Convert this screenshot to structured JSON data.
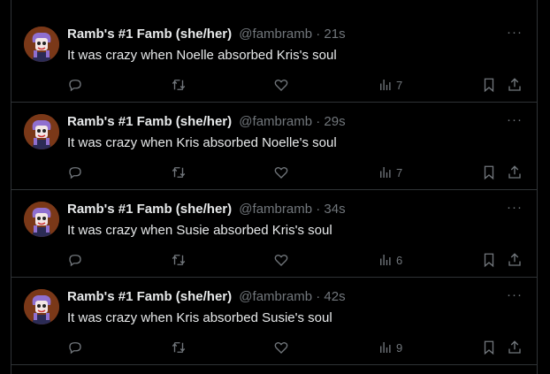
{
  "tweets": [
    {
      "name": "Ramb's #1 Famb (she/her)",
      "handle": "@fambramb",
      "sep": "·",
      "time": "21s",
      "text": "It was crazy when Noelle absorbed Kris's soul",
      "views": "7"
    },
    {
      "name": "Ramb's #1 Famb (she/her)",
      "handle": "@fambramb",
      "sep": "·",
      "time": "29s",
      "text": "It was crazy when Kris absorbed Noelle's soul",
      "views": "7"
    },
    {
      "name": "Ramb's #1 Famb (she/her)",
      "handle": "@fambramb",
      "sep": "·",
      "time": "34s",
      "text": "It was crazy when Susie absorbed Kris's soul",
      "views": "6"
    },
    {
      "name": "Ramb's #1 Famb (she/her)",
      "handle": "@fambramb",
      "sep": "·",
      "time": "42s",
      "text": "It was crazy when Kris absorbed Susie's soul",
      "views": "9"
    }
  ],
  "icons": {
    "more": "more-icon",
    "reply": "reply-icon",
    "retweet": "retweet-icon",
    "like": "heart-icon",
    "views": "views-icon",
    "bookmark": "bookmark-icon",
    "share": "share-icon"
  },
  "colors": {
    "background": "#000000",
    "text": "#e7e9ea",
    "muted": "#71767b",
    "border": "#2f3336"
  }
}
